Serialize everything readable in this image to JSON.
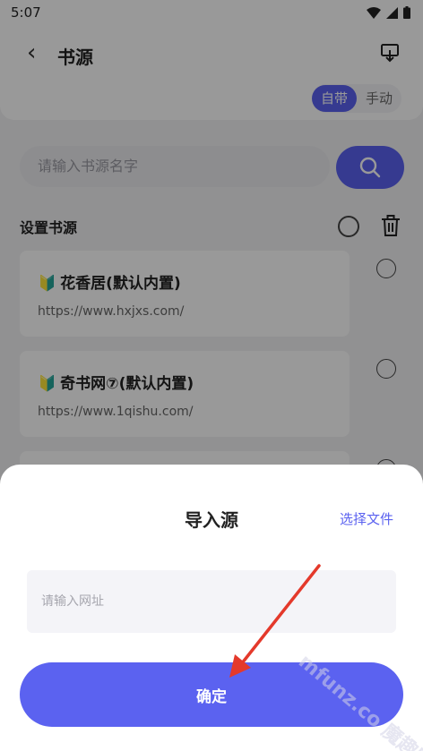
{
  "status_bar": {
    "time": "5:07"
  },
  "header": {
    "back_glyph": "‹",
    "title": "书源",
    "segment": {
      "options": [
        "自带",
        "手动"
      ],
      "selected": "自带"
    }
  },
  "search": {
    "placeholder": "请输入书源名字"
  },
  "section": {
    "title": "设置书源"
  },
  "sources": [
    {
      "badge": "🔰",
      "name": "花香居(默认内置)",
      "url": "https://www.hxjxs.com/"
    },
    {
      "badge": "🔰",
      "name": "奇书网⑦(默认内置)",
      "url": "https://www.1qishu.com/"
    }
  ],
  "dialog": {
    "title": "导入源",
    "choose_file": "选择文件",
    "url_placeholder": "请输入网址",
    "confirm_label": "确定"
  },
  "watermark": "mfunz.co 魔趣网",
  "colors": {
    "accent": "#5b62f0",
    "annotation_arrow": "#e4392b"
  }
}
